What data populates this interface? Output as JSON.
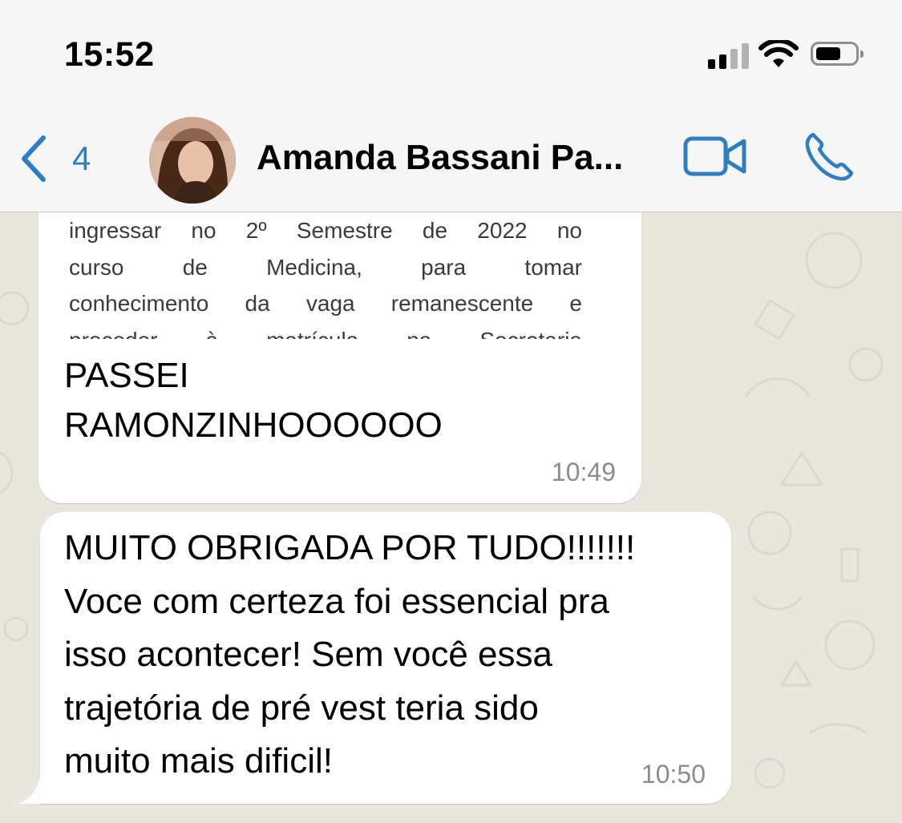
{
  "status_bar": {
    "time": "15:52"
  },
  "header": {
    "back_count": "4",
    "contact_name": "Amanda Bassani Pa..."
  },
  "messages": [
    {
      "document_preview_lines": [
        "ingressar no 2º Semestre de 2022 no",
        "curso de Medicina, para tomar",
        "conhecimento da vaga remanescente e",
        "proceder à matrícula na Secretaria"
      ],
      "text_line1": "PASSEI",
      "text_line2": "RAMONZINHOOOOOO",
      "time": "10:49"
    },
    {
      "text_lines": [
        "MUITO OBRIGADA POR TUDO!!!!!!!",
        "Voce com certeza foi essencial pra",
        "isso acontecer! Sem você essa",
        "trajetória de pré vest teria sido",
        "muito mais dificil!"
      ],
      "time": "10:50"
    }
  ],
  "colors": {
    "accent": "#2d7fc1",
    "chat_background": "#e9e6de",
    "bubble": "#ffffff",
    "timestamp": "#8c8c8c"
  },
  "icons": {
    "back": "chevron-left-icon",
    "video": "video-camera-icon",
    "call": "phone-icon",
    "signal": "cellular-signal-icon",
    "wifi": "wifi-icon",
    "battery": "battery-icon"
  }
}
